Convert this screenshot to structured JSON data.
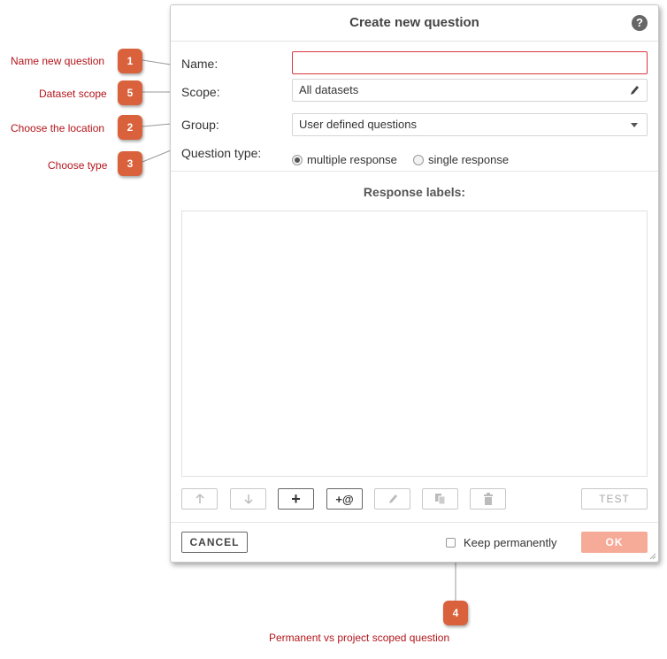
{
  "dialog": {
    "title": "Create new question",
    "help_label": "?",
    "name": {
      "label": "Name:",
      "value": "",
      "placeholder": ""
    },
    "scope": {
      "label": "Scope:",
      "value": "All datasets"
    },
    "group": {
      "label": "Group:",
      "value": "User defined questions"
    },
    "question_type": {
      "label": "Question type:",
      "options": [
        "multiple response",
        "single response"
      ],
      "selected": "multiple response"
    },
    "response_labels_title": "Response labels:",
    "toolbar": {
      "add_label": "+",
      "add_at_label": "+@",
      "test_label": "TEST"
    },
    "footer": {
      "cancel_label": "CANCEL",
      "keep_label": "Keep permanently",
      "ok_label": "OK"
    }
  },
  "annotations": [
    {
      "number": "1",
      "text": "Name new question"
    },
    {
      "number": "5",
      "text": "Dataset scope"
    },
    {
      "number": "2",
      "text": "Choose the location"
    },
    {
      "number": "3",
      "text": "Choose type"
    },
    {
      "number": "4",
      "text": "Permanent vs project scoped question"
    }
  ],
  "colors": {
    "annotation_badge": "#d9613b",
    "annotation_text": "#b3151b",
    "ok_button": "#f6ab98",
    "name_field_border": "#d9363e"
  }
}
